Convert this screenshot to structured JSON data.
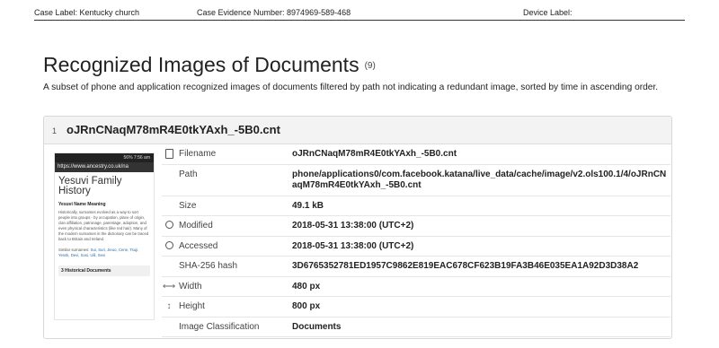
{
  "header": {
    "case_label": "Case Label:  Kentucky church",
    "case_evidence": "Case Evidence Number: 8974969-589-468",
    "device_label": "Device Label:"
  },
  "title": "Recognized Images of Documents",
  "count": "(9)",
  "description": "A subset of phone and application recognized images of documents filtered by path not indicating a redundant image, sorted by time in ascending order.",
  "record": {
    "index": "1",
    "name": "oJRnCNaqM78mR4E0tkYAxh_-5B0.cnt",
    "thumbnail": {
      "status": "56% 7:56 am",
      "url": "https://www.ancestry.co.uk/na",
      "title": "Yesuvi Family History",
      "subtitle": "Yesuvi Name Meaning",
      "body": "Historically, surnames evolved as a way to sort people into groups - by occupation, place of origin, clan affiliation, patronage, parentage, adoption, and even physical characteristics (like red hair). Many of the modern surnames in the dictionary can be traced back to Britain and Ireland.",
      "similar_label": "Similar surnames:",
      "similar_names": "Sui, Suri, Jieuo, Cene, Tsuji, Yessk, Devi, Susi, Ulil, Sevi",
      "historical": "3 Historical Documents"
    },
    "properties": [
      {
        "icon": "file-icon",
        "key": "Filename",
        "value": "oJRnCNaqM78mR4E0tkYAxh_-5B0.cnt"
      },
      {
        "icon": "",
        "key": "Path",
        "value": "phone/applications0/com.facebook.katana/live_data/cache/image/v2.ols100.1/4/oJRnCNaqM78mR4E0tkYAxh_-5B0.cnt"
      },
      {
        "icon": "",
        "key": "Size",
        "value": "49.1 kB"
      },
      {
        "icon": "clock-icon",
        "key": "Modified",
        "value": "2018-05-31 13:38:00 (UTC+2)"
      },
      {
        "icon": "clock-icon",
        "key": "Accessed",
        "value": "2018-05-31 13:38:00 (UTC+2)"
      },
      {
        "icon": "",
        "key": "SHA-256 hash",
        "value": "3D6765352781ED1957C9862E819EAC678CF623B19FA3B46E035EA1A92D3D38A2"
      },
      {
        "icon": "width-icon",
        "key": "Width",
        "value": "480 px"
      },
      {
        "icon": "height-icon",
        "key": "Height",
        "value": "800 px"
      },
      {
        "icon": "",
        "key": "Image Classification",
        "value": "Documents"
      }
    ]
  }
}
